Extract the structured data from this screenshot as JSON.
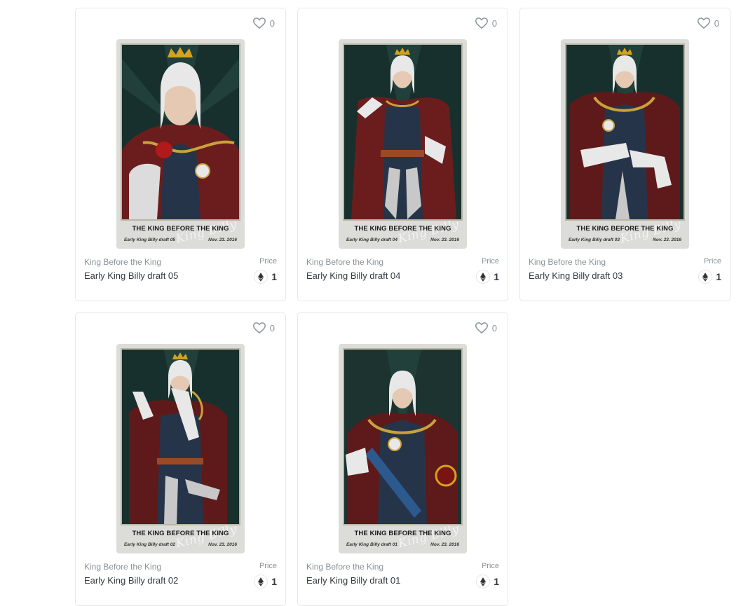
{
  "items": [
    {
      "likes": "0",
      "collection": "King Before the King",
      "name": "Early King Billy draft 05",
      "price_label": "Price",
      "price": "1",
      "card_title": "THE KING BEFORE THE KING",
      "card_draft": "Early King Billy draft 05",
      "card_date": "Nov. 23. 2016",
      "signature": "King Billy"
    },
    {
      "likes": "0",
      "collection": "King Before the King",
      "name": "Early King Billy draft 04",
      "price_label": "Price",
      "price": "1",
      "card_title": "THE KING BEFORE THE KING",
      "card_draft": "Early King Billy draft 04",
      "card_date": "Nov. 23. 2016",
      "signature": "King Billy"
    },
    {
      "likes": "0",
      "collection": "King Before the King",
      "name": "Early King Billy draft 03",
      "price_label": "Price",
      "price": "1",
      "card_title": "THE KING BEFORE THE KING",
      "card_draft": "Early King Billy draft 03",
      "card_date": "Nov. 23. 2016",
      "signature": "King Billy"
    },
    {
      "likes": "0",
      "collection": "King Before the King",
      "name": "Early King Billy draft 02",
      "price_label": "Price",
      "price": "1",
      "card_title": "THE KING BEFORE THE KING",
      "card_draft": "Early King Billy draft 02",
      "card_date": "Nov. 23. 2016",
      "signature": "King Billy"
    },
    {
      "likes": "0",
      "collection": "King Before the King",
      "name": "Early King Billy draft 01",
      "price_label": "Price",
      "price": "1",
      "card_title": "THE KING BEFORE THE KING",
      "card_draft": "Early King Billy draft 01",
      "card_date": "Nov. 23. 2016",
      "signature": "King Billy"
    }
  ],
  "icons": {
    "like": "heart-icon",
    "currency": "ethereum-icon"
  },
  "colors": {
    "card_border": "#e5e8eb",
    "muted_text": "#8a939b",
    "primary_text": "#353840",
    "art_background": "#18302d"
  }
}
